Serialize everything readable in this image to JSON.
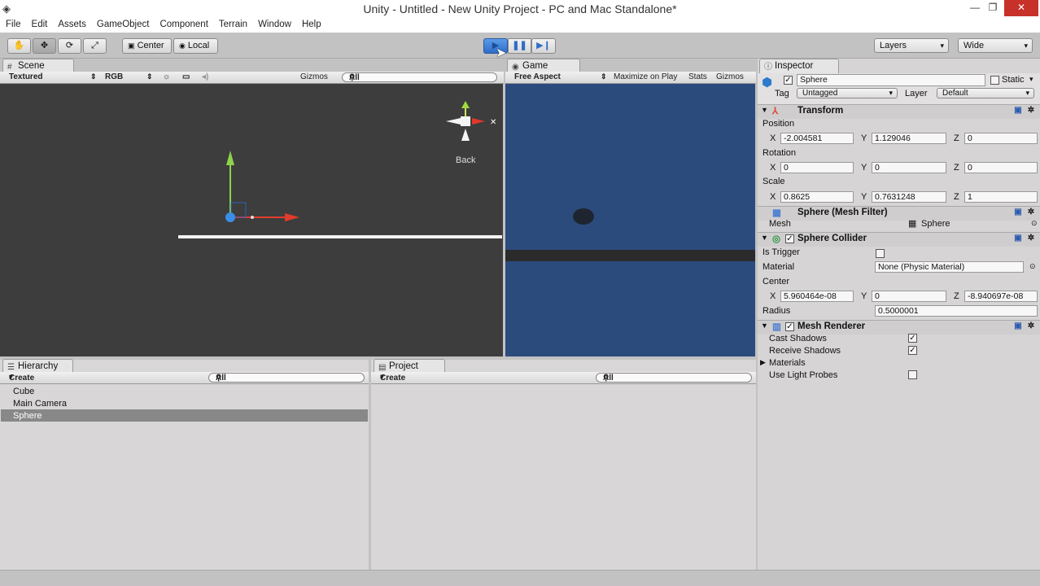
{
  "window": {
    "title": "Unity - Untitled - New Unity Project - PC and Mac Standalone*",
    "minimize": "—",
    "maximize": "❐",
    "close": "✕"
  },
  "menu": [
    "File",
    "Edit",
    "Assets",
    "GameObject",
    "Component",
    "Terrain",
    "Window",
    "Help"
  ],
  "toolbar": {
    "center_label": "Center",
    "local_label": "Local",
    "layers_label": "Layers",
    "layout_label": "Wide"
  },
  "scene": {
    "tab": "Scene",
    "render_mode": "Textured",
    "channel": "RGB",
    "gizmos": "Gizmos",
    "search_placeholder": "All",
    "view_label": "Back"
  },
  "game": {
    "tab": "Game",
    "aspect": "Free Aspect",
    "maximize": "Maximize on Play",
    "stats": "Stats",
    "gizmos": "Gizmos"
  },
  "hierarchy": {
    "tab": "Hierarchy",
    "create": "Create",
    "search_placeholder": "All",
    "items": [
      "Cube",
      "Main Camera",
      "Sphere"
    ]
  },
  "project": {
    "tab": "Project",
    "create": "Create",
    "search_placeholder": "All"
  },
  "inspector": {
    "tab": "Inspector",
    "object_name": "Sphere",
    "static_label": "Static",
    "tag_label": "Tag",
    "tag_value": "Untagged",
    "layer_label": "Layer",
    "layer_value": "Default",
    "transform": {
      "title": "Transform",
      "position_label": "Position",
      "rotation_label": "Rotation",
      "scale_label": "Scale",
      "position": {
        "x": "-2.004581",
        "y": "1.129046",
        "z": "0"
      },
      "rotation": {
        "x": "0",
        "y": "0",
        "z": "0"
      },
      "scale": {
        "x": "0.8625",
        "y": "0.7631248",
        "z": "1"
      }
    },
    "mesh_filter": {
      "title": "Sphere (Mesh Filter)",
      "mesh_label": "Mesh",
      "mesh_value": "Sphere"
    },
    "collider": {
      "title": "Sphere Collider",
      "is_trigger_label": "Is Trigger",
      "material_label": "Material",
      "material_value": "None (Physic Material)",
      "center_label": "Center",
      "center": {
        "x": "5.960464e-08",
        "y": "0",
        "z": "-8.940697e-08"
      },
      "radius_label": "Radius",
      "radius_value": "0.5000001"
    },
    "renderer": {
      "title": "Mesh Renderer",
      "cast_shadows": "Cast Shadows",
      "receive_shadows": "Receive Shadows",
      "materials": "Materials",
      "light_probes": "Use Light Probes"
    },
    "axis": {
      "x": "X",
      "y": "Y",
      "z": "Z"
    }
  },
  "colors": {
    "game_bg": "#2c4b7d",
    "scene_bg": "#3d3d3d",
    "accent_blue": "#3a72c9"
  }
}
